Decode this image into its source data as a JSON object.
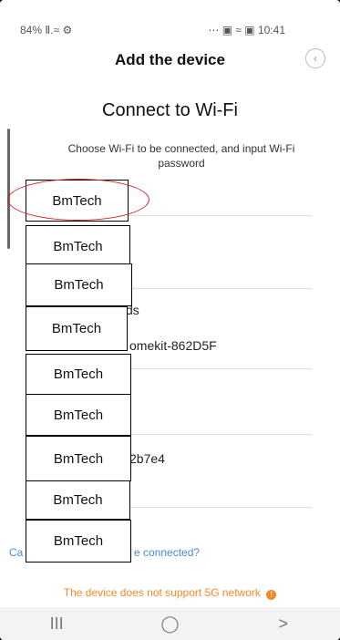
{
  "status_bar": {
    "left": "84% Ⅱ.≈ ⚙",
    "right": "⋯ ▣ ≈ ▣ 10:41"
  },
  "header": {
    "title": "Add the device",
    "back_icon": "‹"
  },
  "content": {
    "subtitle": "Connect to Wi-Fi",
    "description": "Choose Wi-Fi to be connected, and input Wi-Fi password",
    "visible_fragments": [
      "ds",
      "omekit-862D5F",
      "2b7e4"
    ],
    "help_link_left": "Ca",
    "help_link_right": "e connected?",
    "warning": "The device does not support 5G network",
    "warning_icon": "!"
  },
  "overlay_labels": [
    "BmTech",
    "BmTech",
    "BmTech",
    "BmTech",
    "BmTech",
    "BmTech",
    "BmTech",
    "BmTech",
    "BmTech"
  ],
  "navbar": {
    "recent": "III",
    "home": "◯",
    "back": ">"
  }
}
